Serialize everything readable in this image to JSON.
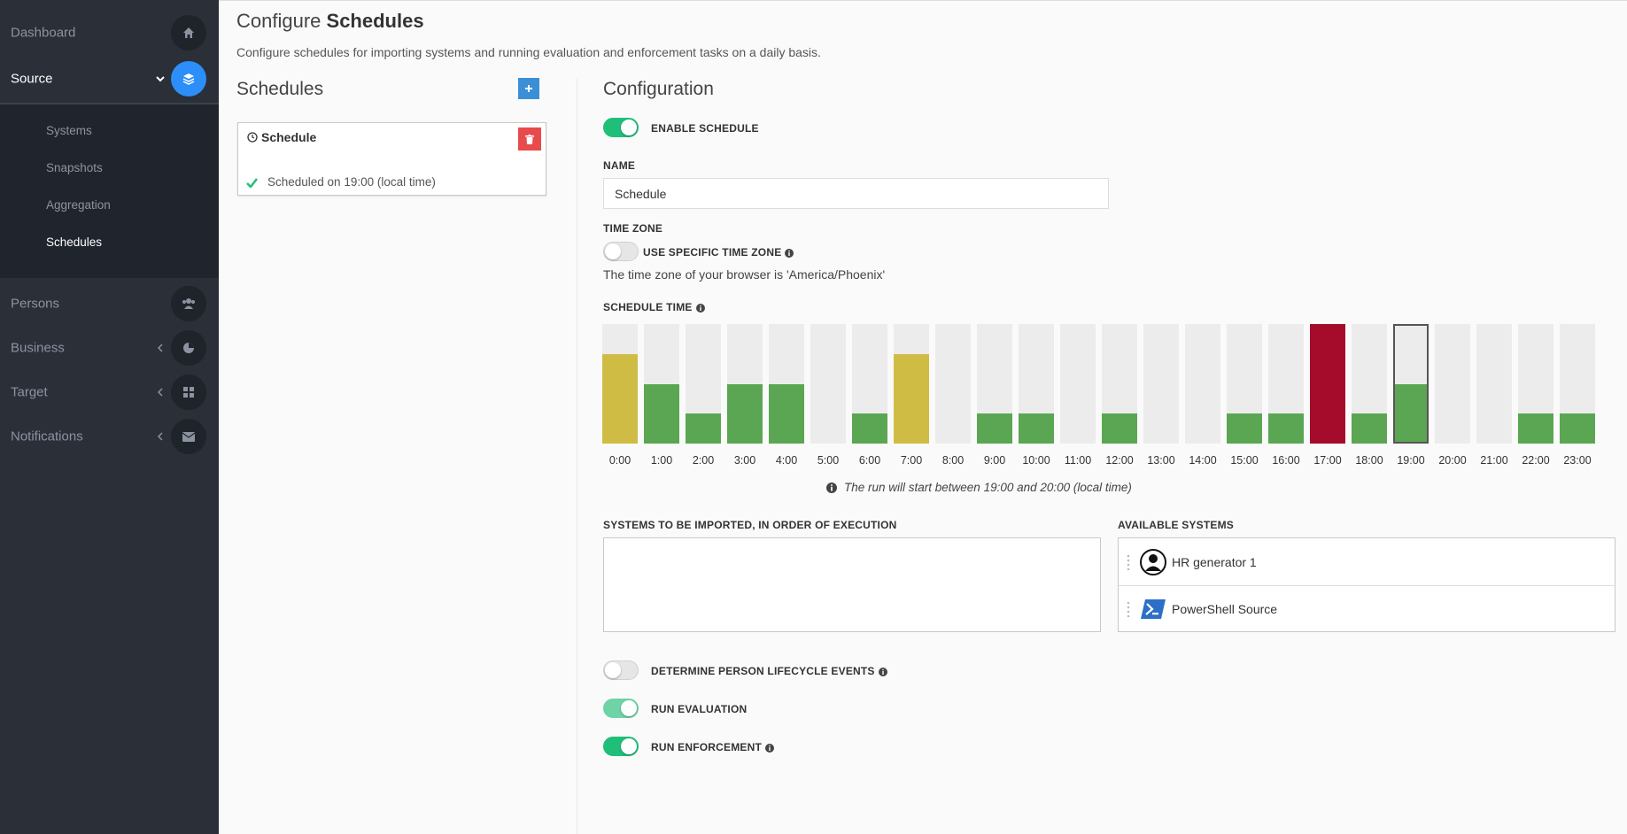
{
  "sidebar": {
    "items": [
      {
        "label": "Dashboard",
        "icon": "home-icon"
      },
      {
        "label": "Source",
        "icon": "layers-icon"
      },
      {
        "label": "Persons",
        "icon": "users-icon"
      },
      {
        "label": "Business",
        "icon": "pie-icon"
      },
      {
        "label": "Target",
        "icon": "grid-icon"
      },
      {
        "label": "Notifications",
        "icon": "envelope-icon"
      }
    ],
    "submenu": [
      "Systems",
      "Snapshots",
      "Aggregation",
      "Schedules"
    ]
  },
  "page": {
    "title_light": "Configure",
    "title_bold": "Schedules",
    "description": "Configure schedules for importing systems and running evaluation and enforcement tasks on a daily basis."
  },
  "schedules": {
    "heading": "Schedules",
    "card_title": "Schedule",
    "card_status": "Scheduled on 19:00 (local time)"
  },
  "config": {
    "heading": "Configuration",
    "enable_label": "ENABLE SCHEDULE",
    "name_label": "NAME",
    "name_value": "Schedule",
    "tz_label": "TIME ZONE",
    "tz_toggle_label": "USE SPECIFIC TIME ZONE",
    "tz_info": "The time zone of your browser is 'America/Phoenix'",
    "schedule_time_label": "SCHEDULE TIME",
    "run_info": "The run will start between 19:00 and 20:00 (local time)",
    "import_label": "SYSTEMS TO BE IMPORTED, IN ORDER OF EXECUTION",
    "available_label": "AVAILABLE SYSTEMS",
    "available_systems": [
      "HR generator 1",
      "PowerShell Source"
    ],
    "lifecycle_label": "DETERMINE PERSON LIFECYCLE EVENTS",
    "evaluation_label": "RUN EVALUATION",
    "enforcement_label": "RUN ENFORCEMENT"
  },
  "colors": {
    "green": "#5ba653",
    "yellow": "#cfbc45",
    "red": "#a50b2b",
    "accent": "#2c8ef8"
  },
  "chart_data": {
    "type": "bar",
    "categories": [
      "0:00",
      "1:00",
      "2:00",
      "3:00",
      "4:00",
      "5:00",
      "6:00",
      "7:00",
      "8:00",
      "9:00",
      "10:00",
      "11:00",
      "12:00",
      "13:00",
      "14:00",
      "15:00",
      "16:00",
      "17:00",
      "18:00",
      "19:00",
      "20:00",
      "21:00",
      "22:00",
      "23:00"
    ],
    "values": [
      0.75,
      0.5,
      0.25,
      0.5,
      0.5,
      0,
      0.25,
      0.75,
      0,
      0.25,
      0.25,
      0,
      0.25,
      0,
      0,
      0.25,
      0.25,
      1.0,
      0.25,
      0.5,
      0,
      0,
      0.25,
      0.25
    ],
    "colors": [
      "yellow",
      "green",
      "green",
      "green",
      "green",
      "none",
      "green",
      "yellow",
      "none",
      "green",
      "green",
      "none",
      "green",
      "none",
      "none",
      "green",
      "green",
      "red",
      "green",
      "green",
      "none",
      "none",
      "green",
      "green"
    ],
    "selected_index": 19,
    "ylim": [
      0,
      1
    ]
  }
}
